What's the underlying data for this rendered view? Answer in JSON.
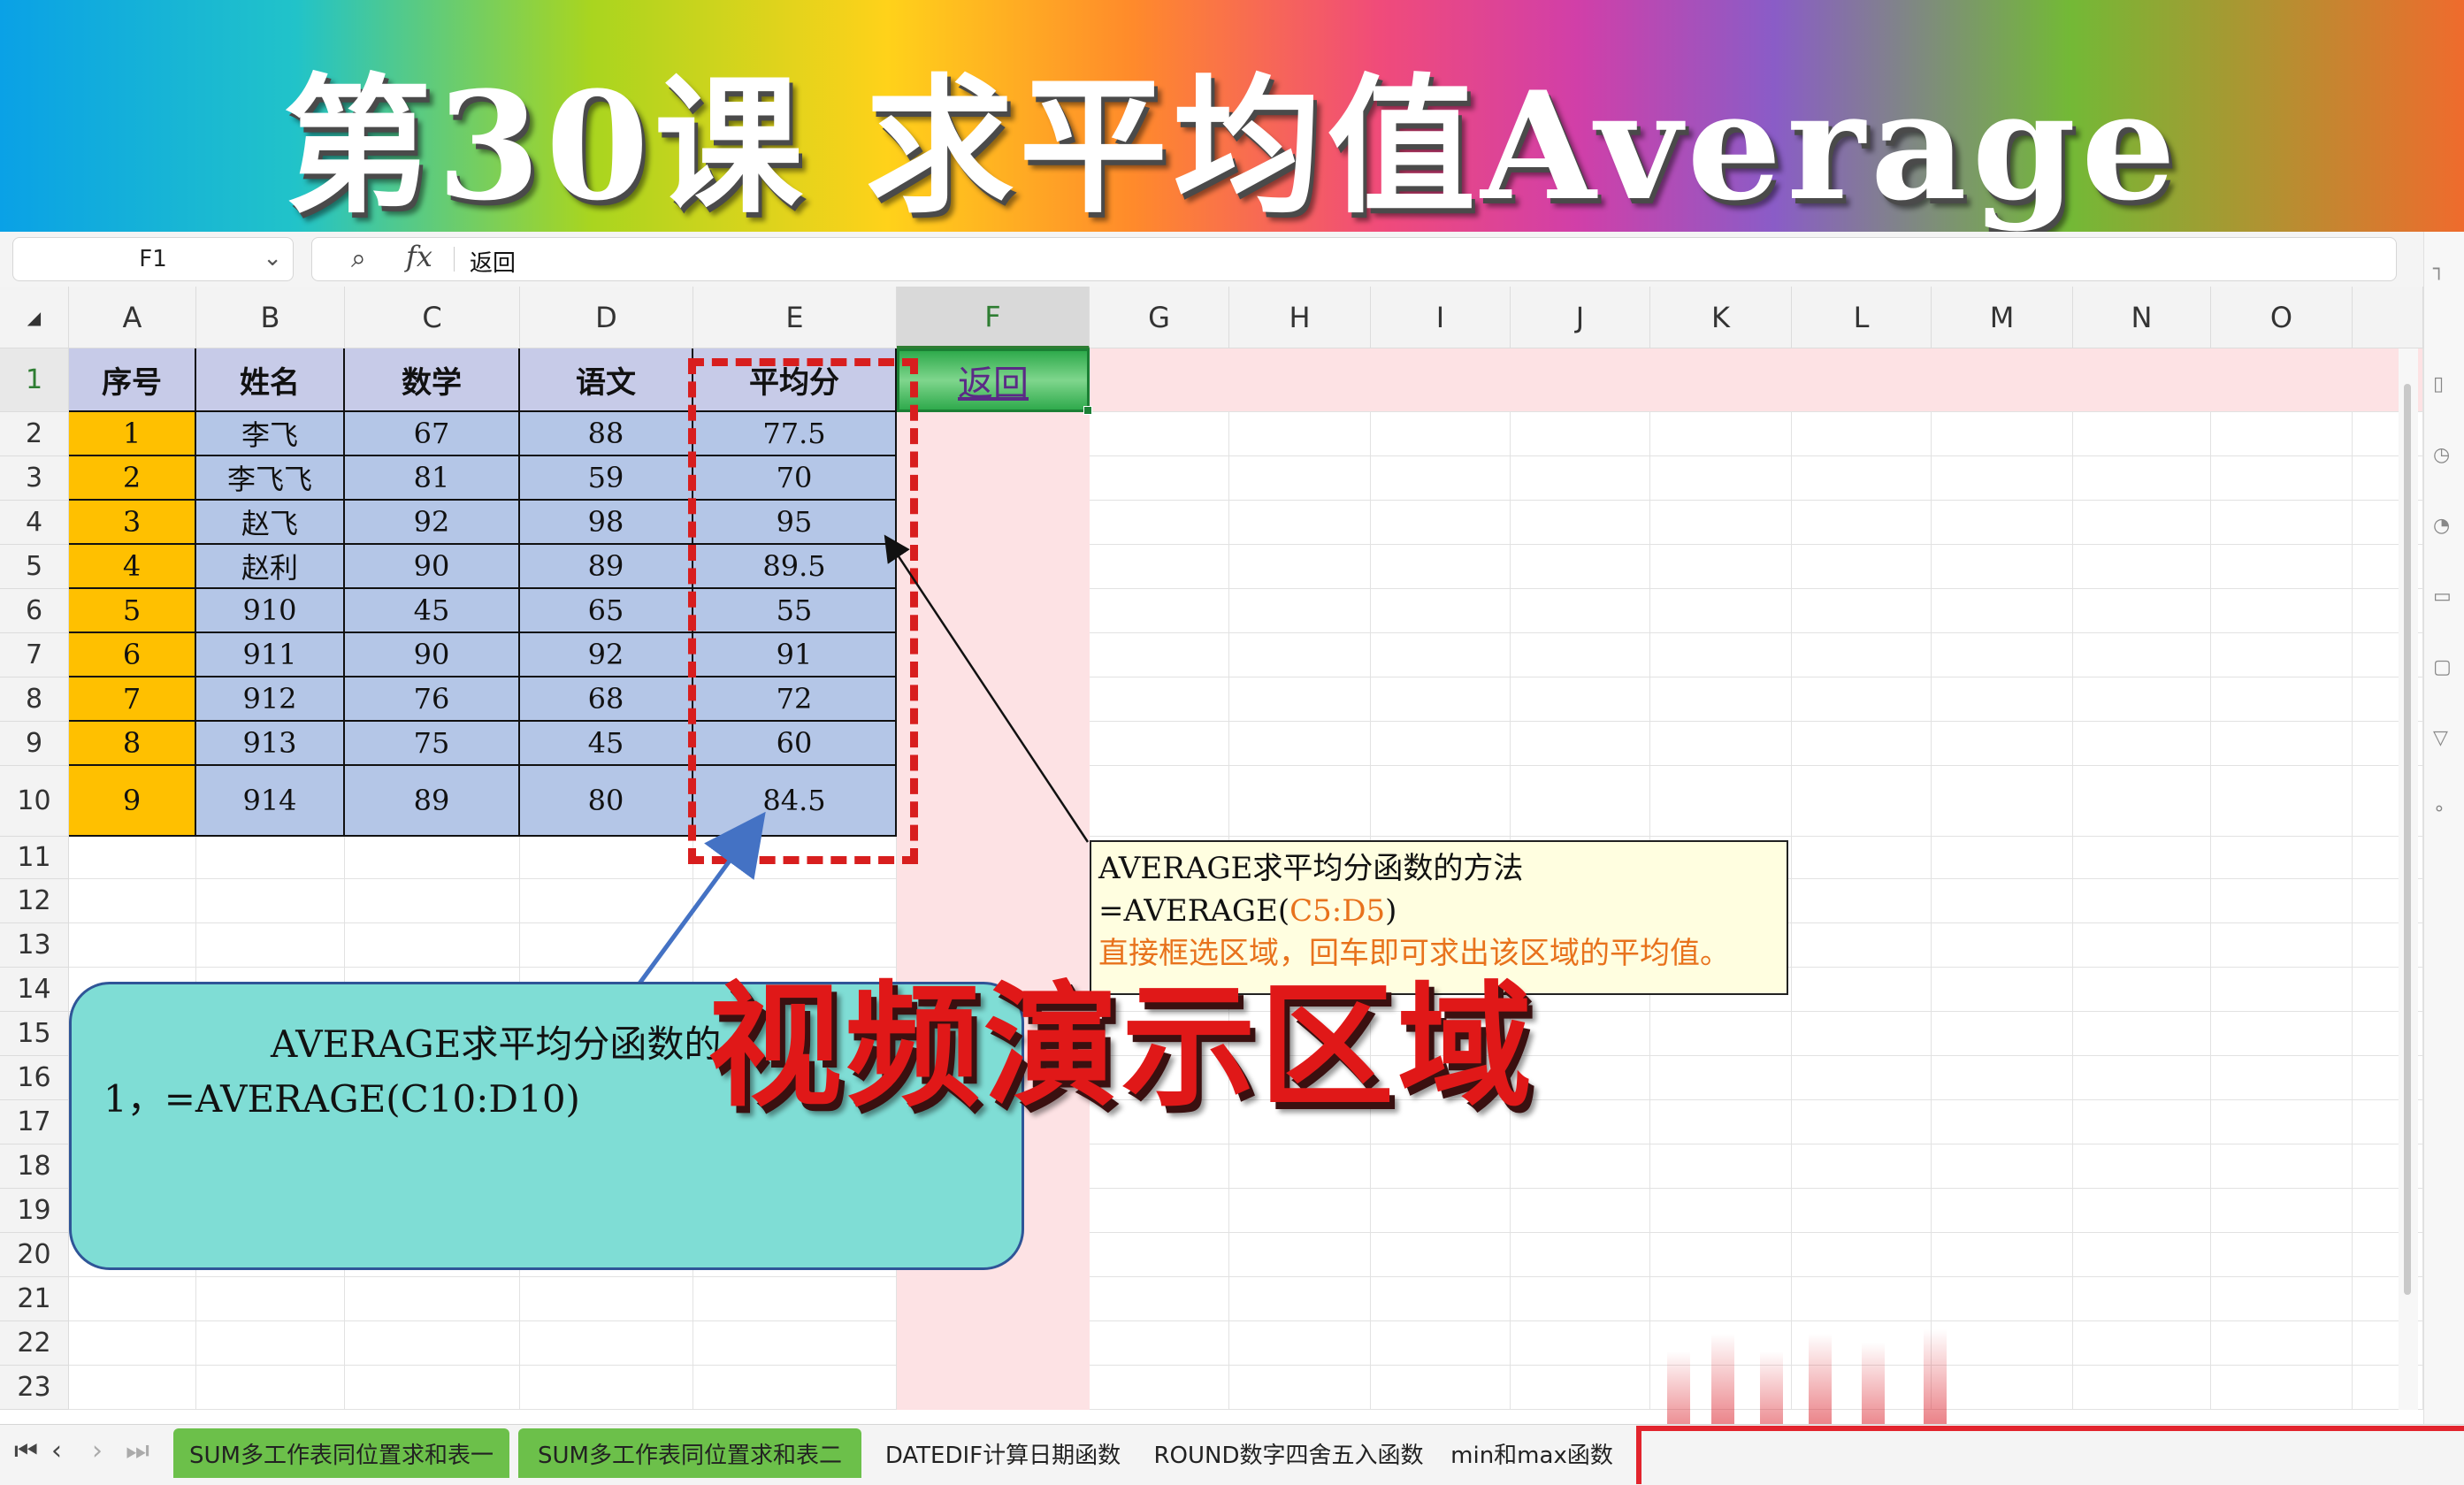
{
  "banner": {
    "title": "第30课 求平均值Average"
  },
  "formula_bar": {
    "cell_ref": "F1",
    "formula": "返回"
  },
  "columns": [
    "A",
    "B",
    "C",
    "D",
    "E",
    "F",
    "G",
    "H",
    "I",
    "J",
    "K",
    "L",
    "M",
    "N",
    "O"
  ],
  "rows": [
    "1",
    "2",
    "3",
    "4",
    "5",
    "6",
    "7",
    "8",
    "9",
    "10",
    "11",
    "12",
    "13",
    "14",
    "15",
    "16",
    "17",
    "18",
    "19",
    "20",
    "21",
    "22",
    "23"
  ],
  "table": {
    "headers": [
      "序号",
      "姓名",
      "数学",
      "语文",
      "平均分"
    ],
    "data": [
      [
        "1",
        "李飞",
        "67",
        "88",
        "77.5"
      ],
      [
        "2",
        "李飞飞",
        "81",
        "59",
        "70"
      ],
      [
        "3",
        "赵飞",
        "92",
        "98",
        "95"
      ],
      [
        "4",
        "赵利",
        "90",
        "89",
        "89.5"
      ],
      [
        "5",
        "910",
        "45",
        "65",
        "55"
      ],
      [
        "6",
        "911",
        "90",
        "92",
        "91"
      ],
      [
        "7",
        "912",
        "76",
        "68",
        "72"
      ],
      [
        "8",
        "913",
        "75",
        "45",
        "60"
      ],
      [
        "9",
        "914",
        "89",
        "80",
        "84.5"
      ]
    ]
  },
  "return_button": {
    "label": "返回"
  },
  "note_box": {
    "line1": "AVERAGE求平均分函数的方法",
    "line2a": "=AVERAGE(",
    "line2b": "C5:D5",
    "line2c": ")",
    "line3": "直接框选区域，回车即可求出该区域的平均值。"
  },
  "teal_box": {
    "line1": "AVERAGE求平均分函数的",
    "line2": "1，=AVERAGE(C10:D10)"
  },
  "overlay": {
    "text": "视频演示区域"
  },
  "sheet_tabs": [
    "SUM多工作表同位置求和表一",
    "SUM多工作表同位置求和表二",
    "DATEDIF计算日期函数",
    "ROUND数字四舍五入函数",
    "min和max函数"
  ],
  "colors": {
    "orange_fill": "#ffc000",
    "blue_fill": "#b4c6e7",
    "header_fill": "#c7cbe8",
    "highlight_pink": "#fde2e4",
    "tab_green": "#6cc04a",
    "dash_red": "#d81e1e"
  }
}
